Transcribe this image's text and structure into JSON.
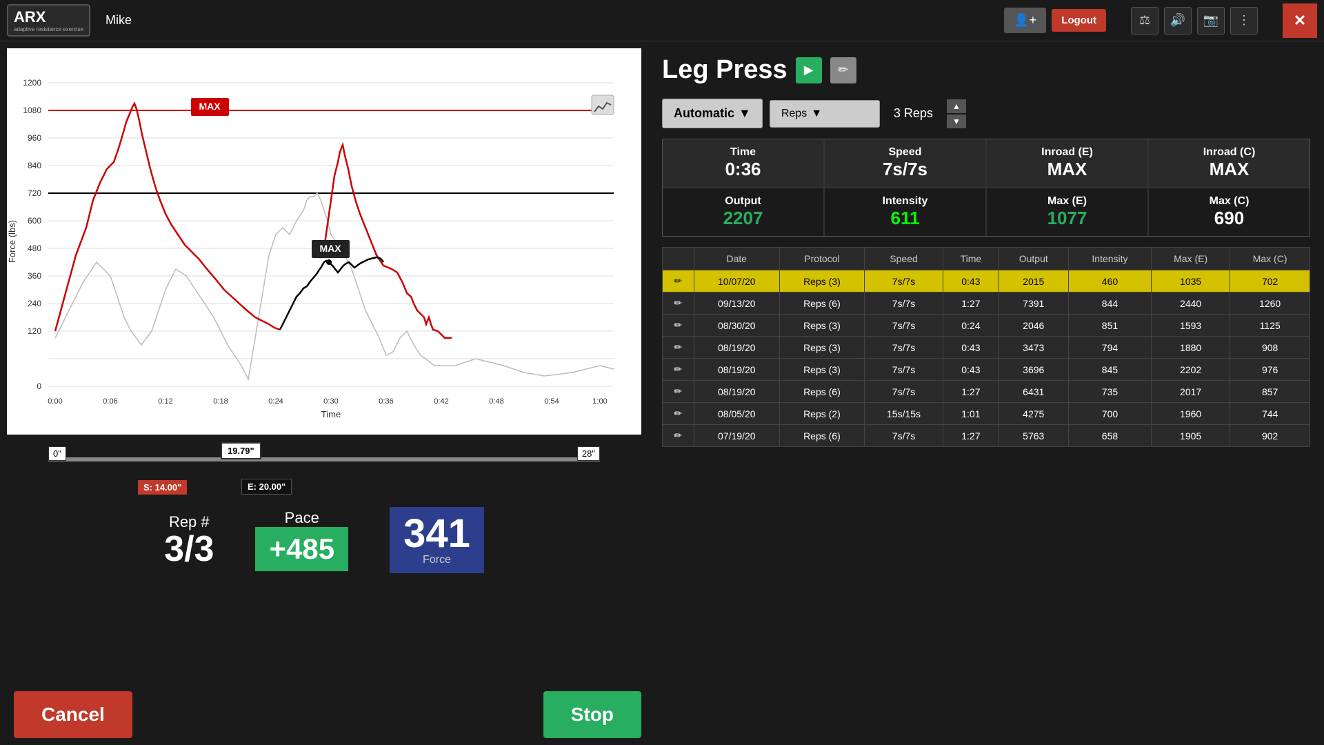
{
  "header": {
    "logo": "ARX",
    "logo_sub": "adaptive resistance exercise",
    "user": "Mike",
    "add_user_icon": "👤+",
    "logout_label": "Logout",
    "icons": {
      "scale": "⚖",
      "volume": "🔊",
      "camera": "📷",
      "menu": "⋮"
    },
    "close": "✕"
  },
  "exercise": {
    "title": "Leg Press",
    "mode": "Automatic",
    "protocol": "Reps",
    "reps_display": "3 Reps"
  },
  "stats": {
    "time_label": "Time",
    "time_value": "0:36",
    "speed_label": "Speed",
    "speed_value": "7s/7s",
    "inroad_e_label": "Inroad (E)",
    "inroad_e_value": "MAX",
    "inroad_c_label": "Inroad (C)",
    "inroad_c_value": "MAX",
    "output_label": "Output",
    "output_value": "2207",
    "intensity_label": "Intensity",
    "intensity_value": "611",
    "max_e_label": "Max (E)",
    "max_e_value": "1077",
    "max_c_label": "Max (C)",
    "max_c_value": "690"
  },
  "rep_info": {
    "rep_label": "Rep #",
    "rep_value": "3/3",
    "pace_label": "Pace",
    "pace_value": "+485",
    "force_value": "341",
    "force_label": "Force"
  },
  "range": {
    "start_marker": "0\"",
    "current_marker": "19.79\"",
    "end_marker": "28\"",
    "s_label": "S: 14.00\"",
    "e_label": "E: 20.00\""
  },
  "buttons": {
    "cancel": "Cancel",
    "stop": "Stop"
  },
  "history": {
    "columns": [
      "Date",
      "Protocol",
      "Speed",
      "Time",
      "Output",
      "Intensity",
      "Max (E)",
      "Max (C)"
    ],
    "rows": [
      {
        "date": "10/07/20",
        "protocol": "Reps (3)",
        "speed": "7s/7s",
        "time": "0:43",
        "output": "2015",
        "intensity": "460",
        "max_e": "1035",
        "max_c": "702",
        "highlighted": true
      },
      {
        "date": "09/13/20",
        "protocol": "Reps (6)",
        "speed": "7s/7s",
        "time": "1:27",
        "output": "7391",
        "intensity": "844",
        "max_e": "2440",
        "max_c": "1260",
        "highlighted": false
      },
      {
        "date": "08/30/20",
        "protocol": "Reps (3)",
        "speed": "7s/7s",
        "time": "0:24",
        "output": "2046",
        "intensity": "851",
        "max_e": "1593",
        "max_c": "1125",
        "highlighted": false
      },
      {
        "date": "08/19/20",
        "protocol": "Reps (3)",
        "speed": "7s/7s",
        "time": "0:43",
        "output": "3473",
        "intensity": "794",
        "max_e": "1880",
        "max_c": "908",
        "highlighted": false
      },
      {
        "date": "08/19/20",
        "protocol": "Reps (3)",
        "speed": "7s/7s",
        "time": "0:43",
        "output": "3696",
        "intensity": "845",
        "max_e": "2202",
        "max_c": "976",
        "highlighted": false
      },
      {
        "date": "08/19/20",
        "protocol": "Reps (6)",
        "speed": "7s/7s",
        "time": "1:27",
        "output": "6431",
        "intensity": "735",
        "max_e": "2017",
        "max_c": "857",
        "highlighted": false
      },
      {
        "date": "08/05/20",
        "protocol": "Reps (2)",
        "speed": "15s/15s",
        "time": "1:01",
        "output": "4275",
        "intensity": "700",
        "max_e": "1960",
        "max_c": "744",
        "highlighted": false
      },
      {
        "date": "07/19/20",
        "protocol": "Reps (6)",
        "speed": "7s/7s",
        "time": "1:27",
        "output": "5763",
        "intensity": "658",
        "max_e": "1905",
        "max_c": "902",
        "highlighted": false
      }
    ]
  }
}
